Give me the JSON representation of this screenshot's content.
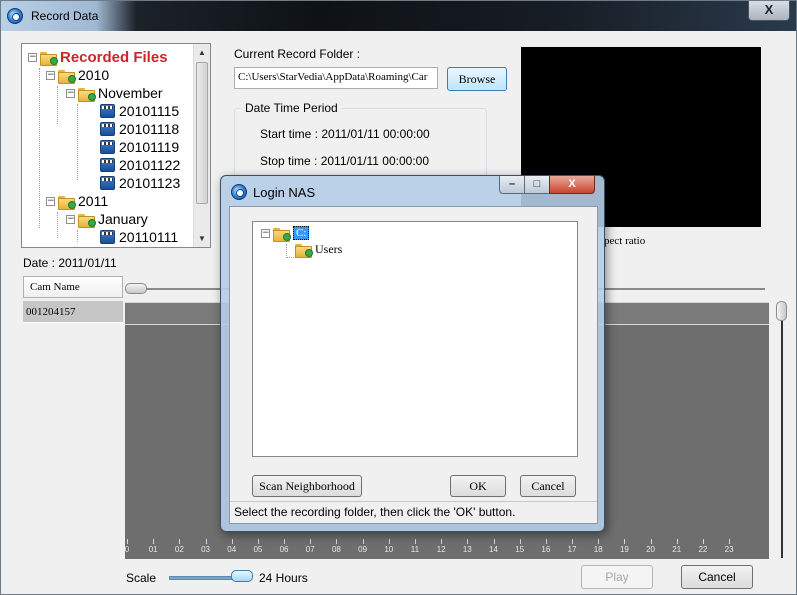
{
  "window": {
    "title": "Record Data",
    "close_glyph": "X"
  },
  "tree": {
    "root": "Recorded Files",
    "years": [
      {
        "label": "2010",
        "months": [
          {
            "label": "November",
            "days": [
              "20101115",
              "20101118",
              "20101119",
              "20101122",
              "20101123"
            ]
          }
        ]
      },
      {
        "label": "2011",
        "months": [
          {
            "label": "January",
            "days": [
              "20110111"
            ]
          }
        ]
      }
    ]
  },
  "folder": {
    "label": "Current Record Folder :",
    "value": "C:\\Users\\StarVedia\\AppData\\Roaming\\Car",
    "browse_label": "Browse"
  },
  "period": {
    "legend": "Date Time Period",
    "start": "Start time : 2011/01/11 00:00:00",
    "stop": "Stop time : 2011/01/11 00:00:00"
  },
  "preview": {
    "aspect_text": "pect ratio"
  },
  "timeline": {
    "date_label": "Date :  2011/01/11",
    "cam_header": "Cam Name",
    "cams": [
      "001204157"
    ],
    "hours": [
      "0",
      "01",
      "02",
      "03",
      "04",
      "05",
      "06",
      "07",
      "08",
      "09",
      "10",
      "11",
      "12",
      "13",
      "14",
      "15",
      "16",
      "17",
      "18",
      "19",
      "20",
      "21",
      "22",
      "23"
    ]
  },
  "bottom": {
    "scale_label": "Scale",
    "scale_value": "24 Hours",
    "play_label": "Play",
    "cancel_label": "Cancel"
  },
  "dialog": {
    "title": "Login NAS",
    "root": "C:",
    "child": "Users",
    "scan_label": "Scan Neighborhood",
    "ok_label": "OK",
    "cancel_label": "Cancel",
    "status": "Select the recording folder, then click the 'OK' button.",
    "min_glyph": "–",
    "max_glyph": "□",
    "close_glyph": "X"
  }
}
